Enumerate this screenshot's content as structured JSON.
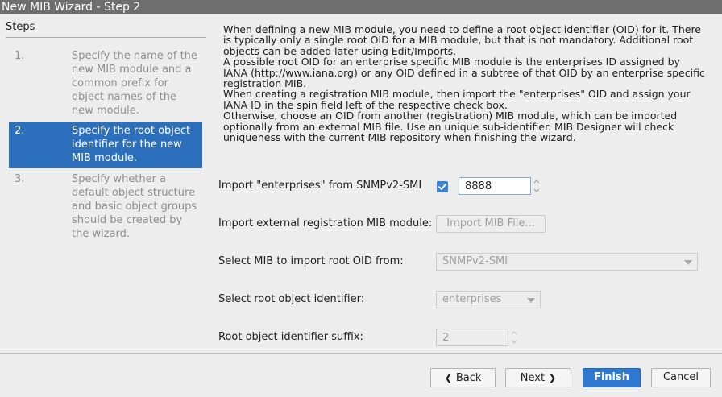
{
  "window": {
    "title": "New MIB Wizard - Step 2"
  },
  "steps": {
    "header": "Steps",
    "items": [
      {
        "number": "1.",
        "text": "Specify the name of the new MIB module and a common prefix for object names of the new module."
      },
      {
        "number": "2.",
        "text": "Specify the root object identifier for the new MIB module."
      },
      {
        "number": "3.",
        "text": "Specify whether a default object structure and basic object groups should be created by the wizard."
      }
    ]
  },
  "description": [
    "When defining a new MIB module, you need to define a root object identifier (OID) for it. There is typically only a single root OID for a MIB module, but that is not mandatory. Additional root objects can be added later using Edit/Imports.",
    "A possible root OID for an enterprise specific MIB module is the enterprises ID assigned by IANA (http://www.iana.org) or any OID defined in a subtree of that OID by an enterprise specific registration MIB.",
    "When creating a registration MIB module, then import the \"enterprises\" OID and assign your IANA ID in the spin field left of the respective check box.",
    "Otherwise, choose an OID from another (registration) MIB module, which can be imported optionally from an external MIB file. Use an unique sub-identifier. MIB Designer will check uniqueness with the current MIB repository when finishing the wizard."
  ],
  "form": {
    "import_enterprises_label": "Import \"enterprises\" from SNMPv2-SMI",
    "enterprise_id": "8888",
    "import_external_label": "Import external registration MIB module:",
    "import_file_button": "Import MIB File...",
    "select_mib_label": "Select MIB to import root OID from:",
    "select_mib_value": "SNMPv2-SMI",
    "select_root_label": "Select root object identifier:",
    "select_root_value": "enterprises",
    "suffix_label": "Root object identifier suffix:",
    "suffix_value": "2"
  },
  "footer": {
    "back": "Back",
    "next": "Next",
    "finish": "Finish",
    "cancel": "Cancel"
  },
  "colors": {
    "accent": "#2c6fbd",
    "primary_button": "#2e78d2",
    "titlebar": "#6e6e6e"
  }
}
